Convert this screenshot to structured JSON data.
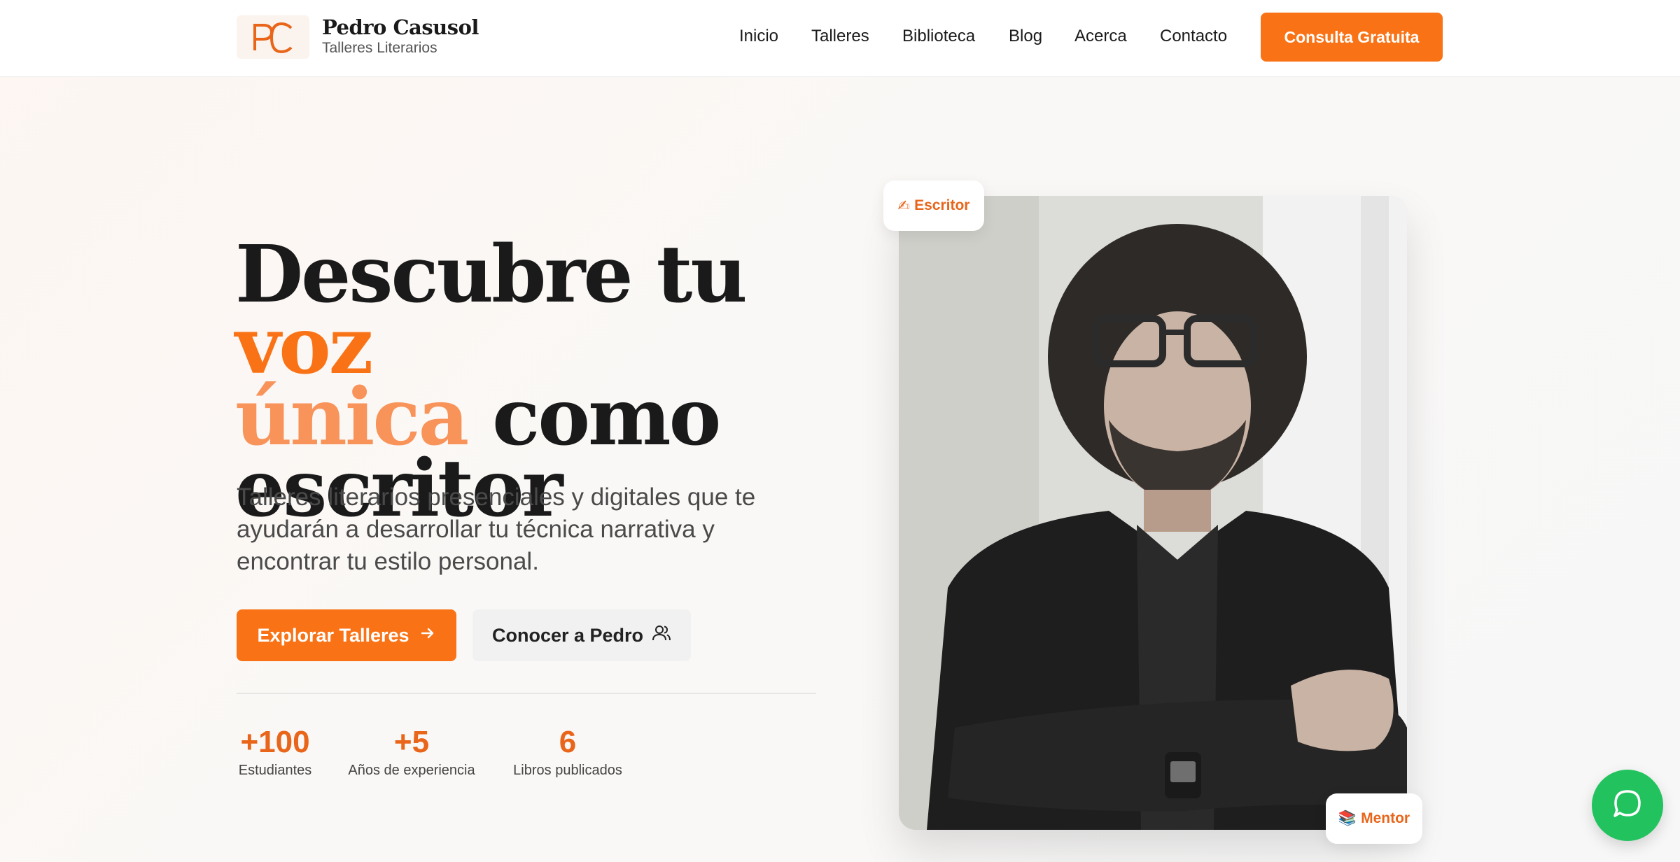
{
  "brand": {
    "monogram": "PC",
    "name": "Pedro Casusol",
    "tagline": "Talleres Literarios",
    "accent_color": "#f97316"
  },
  "nav": {
    "items": [
      {
        "label": "Inicio"
      },
      {
        "label": "Talleres"
      },
      {
        "label": "Biblioteca"
      },
      {
        "label": "Blog"
      },
      {
        "label": "Acerca"
      },
      {
        "label": "Contacto"
      }
    ],
    "cta_label": "Consulta Gratuita"
  },
  "hero": {
    "title_part1": "Descubre tu ",
    "title_accent1": "voz",
    "title_accent2": "única",
    "title_part2": " como",
    "title_part3": "escritor",
    "subtitle": "Talleres literarios presenciales y digitales que te ayudarán a desarrollar tu técnica narrativa y encontrar tu estilo personal.",
    "primary_button": "Explorar Talleres",
    "primary_icon": "arrow-right-icon",
    "secondary_button": "Conocer a Pedro",
    "secondary_icon": "users-icon"
  },
  "stats": [
    {
      "value": "+100",
      "label": "Estudiantes"
    },
    {
      "value": "+5",
      "label": "Años de experiencia"
    },
    {
      "value": "6",
      "label": "Libros publicados"
    }
  ],
  "photo": {
    "badge_top": "Escritor",
    "badge_top_icon": "writing-hand-icon",
    "badge_bottom": "Mentor",
    "badge_bottom_icon": "books-icon"
  },
  "floating": {
    "chat_icon": "whatsapp-chat-icon",
    "chat_color": "#22c35e"
  }
}
